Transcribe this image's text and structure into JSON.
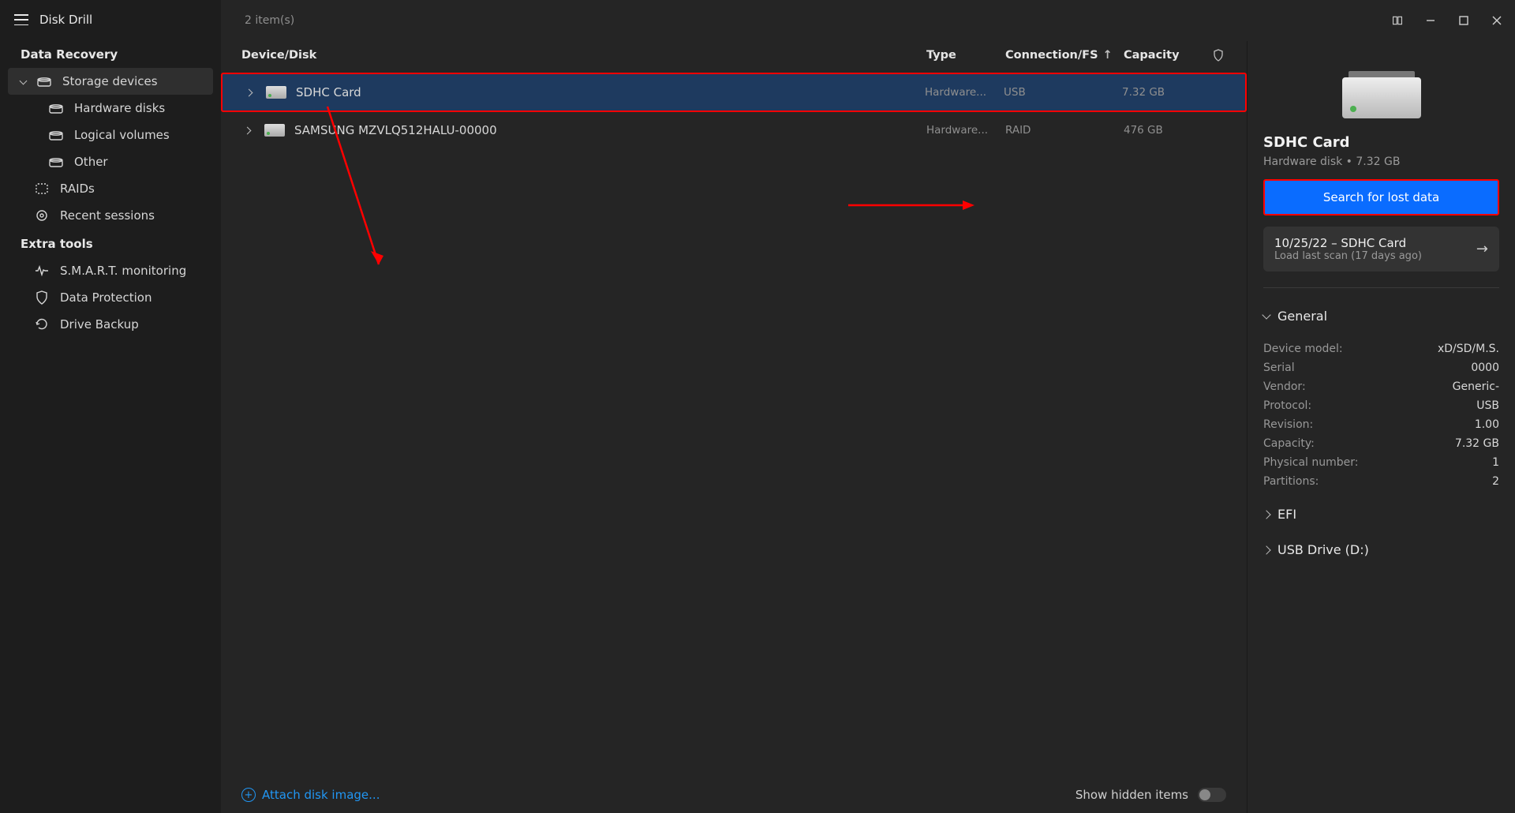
{
  "app_title": "Disk Drill",
  "item_count": "2 item(s)",
  "sidebar": {
    "section1_label": "Data Recovery",
    "storage_devices": "Storage devices",
    "hardware_disks": "Hardware disks",
    "logical_volumes": "Logical volumes",
    "other": "Other",
    "raids": "RAIDs",
    "recent_sessions": "Recent sessions",
    "section2_label": "Extra tools",
    "smart": "S.M.A.R.T. monitoring",
    "data_protection": "Data Protection",
    "drive_backup": "Drive Backup"
  },
  "columns": {
    "device": "Device/Disk",
    "type": "Type",
    "conn": "Connection/FS",
    "cap": "Capacity"
  },
  "rows": [
    {
      "name": "SDHC Card",
      "type": "Hardware...",
      "conn": "USB",
      "cap": "7.32 GB",
      "selected": true
    },
    {
      "name": "SAMSUNG MZVLQ512HALU-00000",
      "type": "Hardware...",
      "conn": "RAID",
      "cap": "476 GB",
      "selected": false
    }
  ],
  "footer": {
    "attach": "Attach disk image...",
    "show_hidden": "Show hidden items"
  },
  "right": {
    "title": "SDHC Card",
    "subtitle": "Hardware disk • 7.32 GB",
    "primary": "Search for lost data",
    "scan_title": "10/25/22 – SDHC Card",
    "scan_sub": "Load last scan (17 days ago)",
    "general_label": "General",
    "props": {
      "device_model_k": "Device model:",
      "device_model_v": "xD/SD/M.S.",
      "serial_k": "Serial",
      "serial_v": "0000",
      "vendor_k": "Vendor:",
      "vendor_v": "Generic-",
      "protocol_k": "Protocol:",
      "protocol_v": "USB",
      "revision_k": "Revision:",
      "revision_v": "1.00",
      "capacity_k": "Capacity:",
      "capacity_v": "7.32 GB",
      "phys_k": "Physical number:",
      "phys_v": "1",
      "part_k": "Partitions:",
      "part_v": "2"
    },
    "efi_label": "EFI",
    "usb_label": "USB Drive (D:)"
  }
}
